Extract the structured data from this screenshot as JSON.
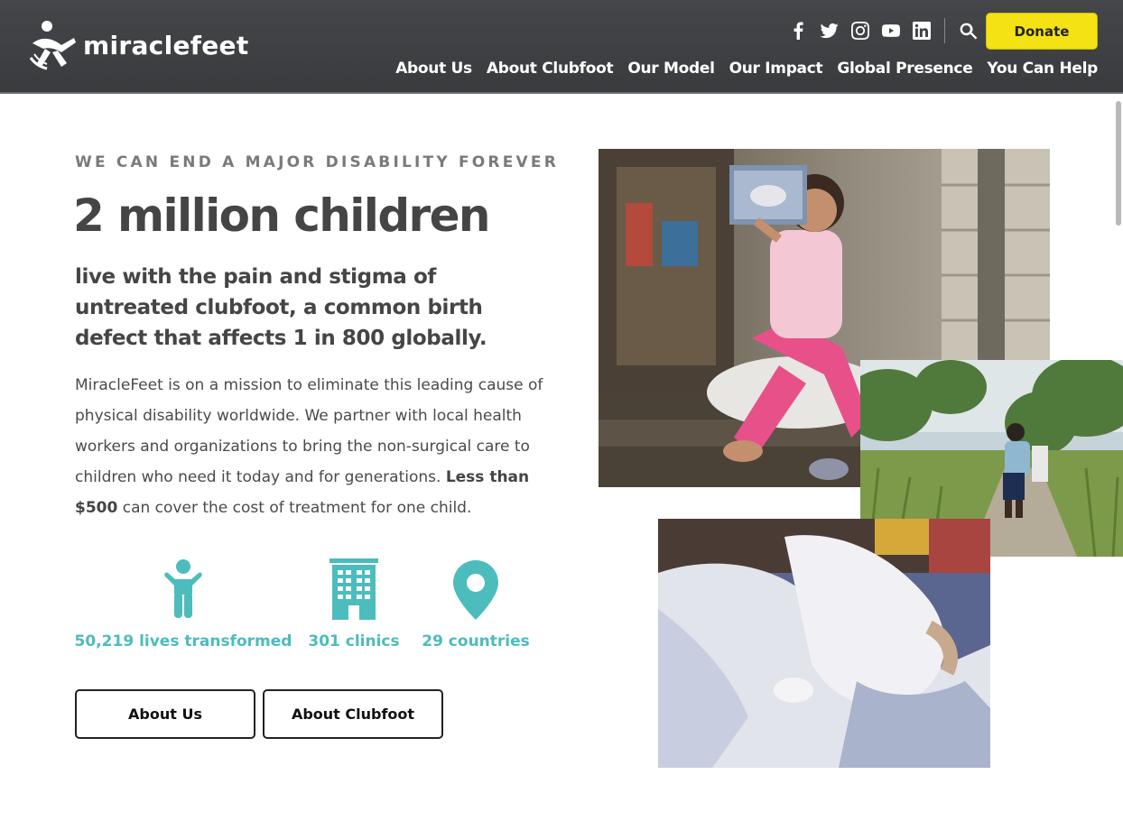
{
  "header": {
    "logo_text": "miraclefeet",
    "donate_label": "Donate",
    "social_icons": [
      "facebook-icon",
      "twitter-icon",
      "instagram-icon",
      "youtube-icon",
      "linkedin-icon"
    ],
    "nav": [
      {
        "label": "About Us"
      },
      {
        "label": "About Clubfoot"
      },
      {
        "label": "Our Model"
      },
      {
        "label": "Our Impact"
      },
      {
        "label": "Global Presence"
      },
      {
        "label": "You Can Help"
      }
    ]
  },
  "hero": {
    "eyebrow": "WE CAN END A MAJOR DISABILITY FOREVER",
    "headline": "2 million children",
    "subhead": "live with the pain and stigma of untreated clubfoot, a common birth defect that affects 1 in 800 globally.",
    "body_lead": "MiracleFeet is on a mission to eliminate this leading cause of physical disability worldwide. We partner with local health workers and organizations to bring the non-surgical care to children who need it today and for generations.",
    "body_strong": "Less than $500",
    "body_tail": "can cover the cost of treatment for one child."
  },
  "stats": [
    {
      "label": "50,219 lives transformed",
      "icon": "child-icon"
    },
    {
      "label": "301 clinics",
      "icon": "building-icon"
    },
    {
      "label": "29 countries",
      "icon": "map-pin-icon"
    }
  ],
  "buttons": {
    "about_us": "About Us",
    "about_clubfoot": "About Clubfoot"
  },
  "colors": {
    "header_bg": "#3f4043",
    "accent_teal": "#4dbcbc",
    "donate_yellow": "#f5e214",
    "text_dark": "#454545"
  }
}
